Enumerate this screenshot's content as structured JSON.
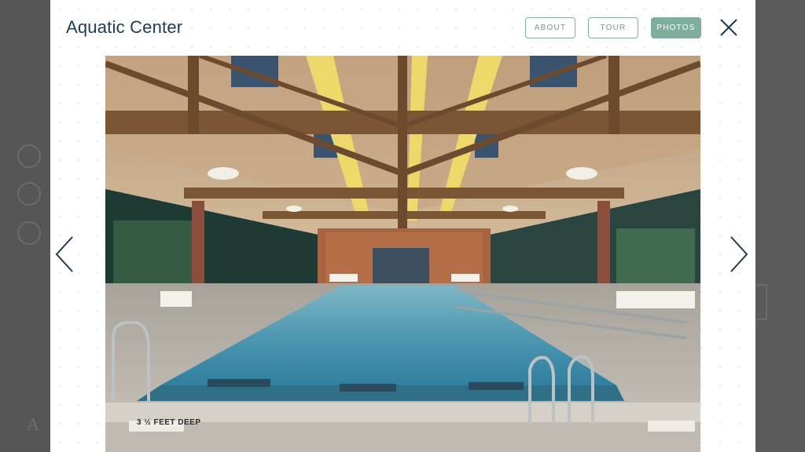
{
  "modal": {
    "title": "Aquatic Center",
    "tabs": [
      {
        "label": "ABOUT",
        "active": false
      },
      {
        "label": "TOUR",
        "active": false
      },
      {
        "label": "PHOTOS",
        "active": true
      }
    ],
    "close_icon": "close-icon",
    "prev_icon": "chevron-left-icon",
    "next_icon": "chevron-right-icon"
  },
  "photo": {
    "signage": "3 ½ FEET DEEP"
  },
  "background": {
    "heading_fragment": "A"
  },
  "colors": {
    "title": "#1f3a52",
    "accent": "#7fae9c",
    "arrow": "#1f3a52",
    "backdrop": "#5a5a5a"
  }
}
